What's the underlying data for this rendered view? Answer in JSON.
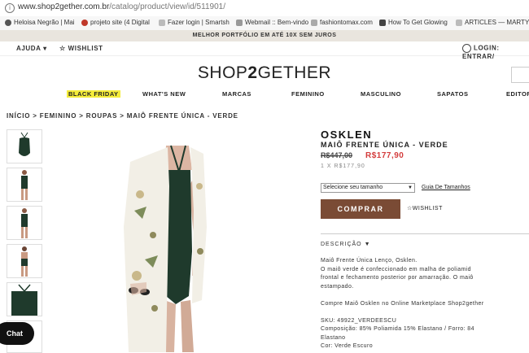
{
  "browser": {
    "url_host": "www.shop2gether.com.br",
    "url_path": "/catalog/product/view/id/511901/"
  },
  "bookmarks": [
    {
      "label": "Heloisa Negrão | Mai",
      "color": "#555555"
    },
    {
      "label": "projeto site (4 Digital",
      "color": "#c0392b"
    },
    {
      "label": "Fazer login | Smartsh",
      "color": "#888888"
    },
    {
      "label": "Webmail :: Bem-vindo",
      "color": "#777777"
    },
    {
      "label": "fashiontomax.com",
      "color": "#999999"
    },
    {
      "label": "How To Get Glowing",
      "color": "#555555"
    },
    {
      "label": "ARTICLES — MARTY",
      "color": "#777777"
    }
  ],
  "promo": "MELHOR PORTFÓLIO EM ATÉ 10X SEM JUROS",
  "util": {
    "help": "AJUDA",
    "wishlist": "WISHLIST",
    "login": "LOGIN: ENTRAR/"
  },
  "logo": {
    "left": "SHOP",
    "mid": "2",
    "right": "GETHER"
  },
  "nav": [
    "BLACK FRIDAY",
    "WHAT'S NEW",
    "MARCAS",
    "FEMININO",
    "MASCULINO",
    "SAPATOS",
    "EDITORI"
  ],
  "breadcrumb": "INÍCIO > FEMININO > ROUPAS > MAIÔ FRENTE ÚNICA - VERDE",
  "product": {
    "brand": "OSKLEN",
    "name": "MAIÔ FRENTE ÚNICA - VERDE",
    "old_price": "R$447,00",
    "price": "R$177,90",
    "installments": "1 X R$177,90",
    "size_select": "Selecione seu tamanho",
    "size_guide": "Guia De Tamanhos",
    "buy_button": "COMPRAR",
    "wishlist": "WISHLIST",
    "description_header": "DESCRIÇÃO",
    "description_lines": [
      "Maiô Frente Única Lenço, Osklen.",
      "O maiô verde é confeccionado em malha de poliamid",
      "frontal e fechamento posterior por amarração. O maiô",
      "estampado.",
      "",
      "Compre Maiô Osklen no Online Marketplace Shop2gether",
      "",
      "SKU: 49922_VERDEESCU",
      "Composição: 85% Poliamida 15% Elastano / Forro: 84",
      "Elastano",
      "Cor: Verde Escuro"
    ]
  },
  "chat": "Chat",
  "colors": {
    "buy_button": "#7a4b35",
    "sale_price": "#d43c3c",
    "black_friday_highlight": "#f4ec3a",
    "swimsuit_green": "#1f3a2c"
  }
}
